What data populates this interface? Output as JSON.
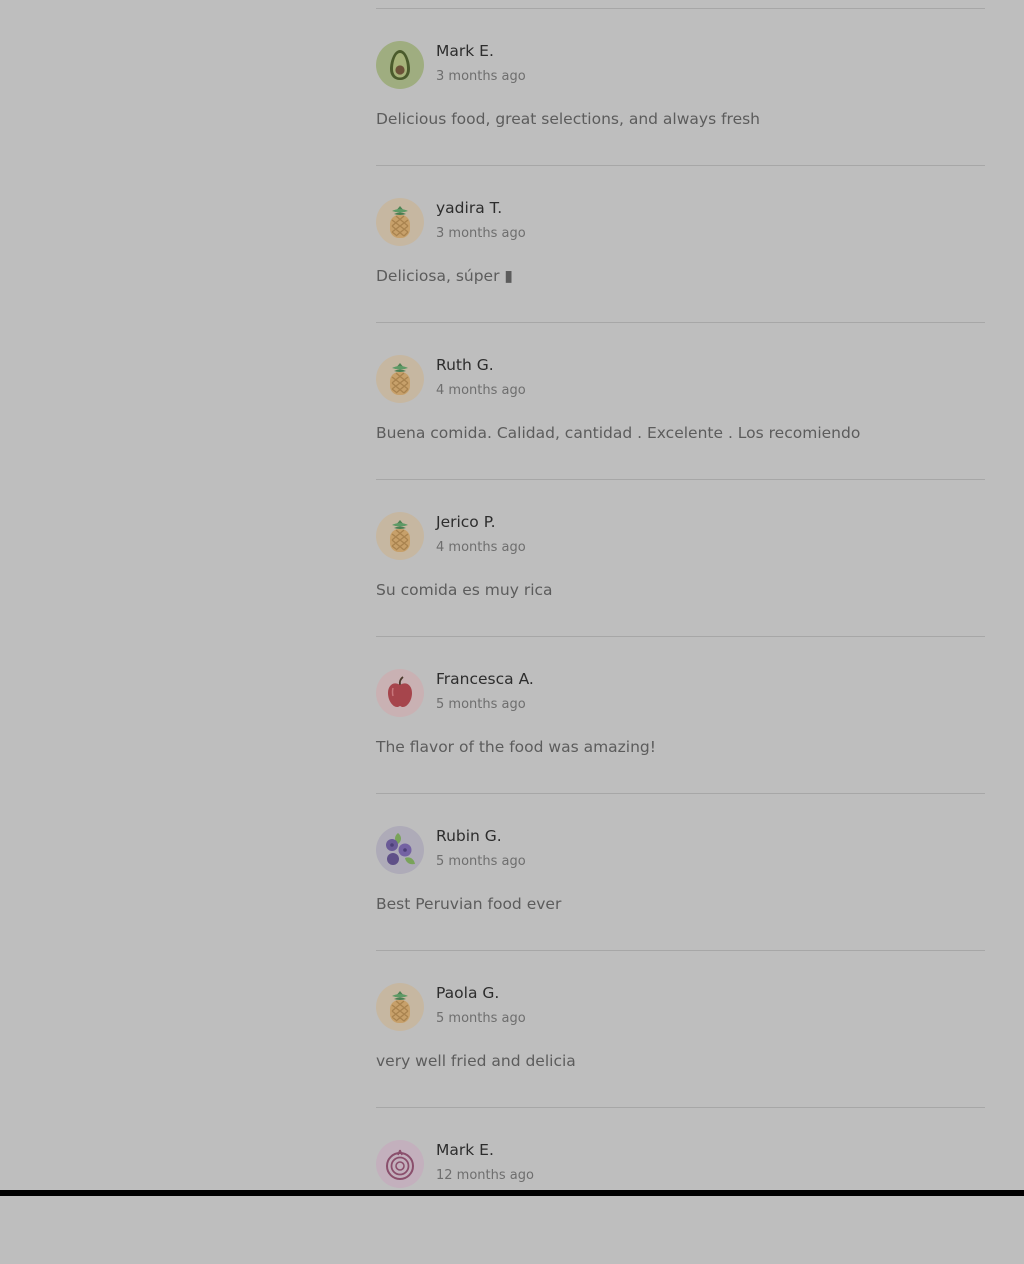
{
  "reviews": [
    {
      "name": "Mark E.",
      "time": "3 months ago",
      "text": "Delicious food, great selections, and always fresh",
      "avatar": "avocado-icon"
    },
    {
      "name": "yadira T.",
      "time": "3 months ago",
      "text": "Deliciosa, súper ▮",
      "avatar": "pineapple-icon"
    },
    {
      "name": "Ruth G.",
      "time": "4 months ago",
      "text": "Buena comida. Calidad, cantidad . Excelente . Los recomiendo",
      "avatar": "pineapple-icon"
    },
    {
      "name": "Jerico P.",
      "time": "4 months ago",
      "text": "Su comida es muy rica",
      "avatar": "pineapple-icon"
    },
    {
      "name": "Francesca A.",
      "time": "5 months ago",
      "text": "The flavor of the food was amazing!",
      "avatar": "apple-icon"
    },
    {
      "name": "Rubin G.",
      "time": "5 months ago",
      "text": "Best Peruvian food ever",
      "avatar": "blueberry-icon"
    },
    {
      "name": "Paola G.",
      "time": "5 months ago",
      "text": "very well fried and delicia",
      "avatar": "pineapple-icon"
    },
    {
      "name": "Mark E.",
      "time": "12 months ago",
      "text": "",
      "avatar": "onion-icon"
    }
  ],
  "colors": {
    "overlay_background": "#bebebe",
    "divider": "#a7a7a7",
    "name_text": "#2d2d2d",
    "time_text": "#6e6e6e",
    "body_text": "#5c5c5c"
  }
}
